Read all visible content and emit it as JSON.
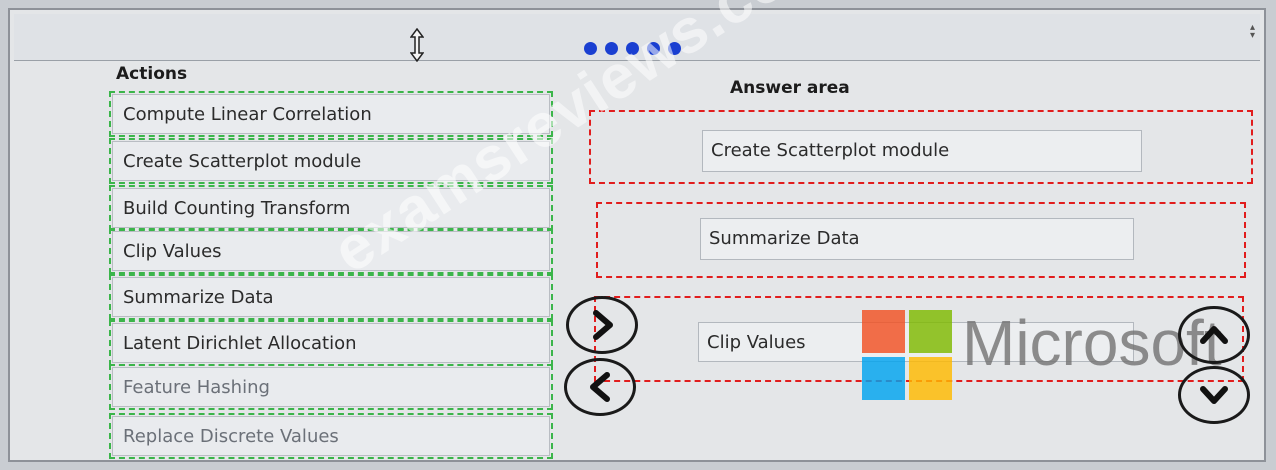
{
  "actions": {
    "title": "Actions",
    "items": [
      "Compute Linear Correlation",
      "Create Scatterplot module",
      "Build Counting Transform",
      "Clip Values",
      "Summarize Data",
      "Latent Dirichlet Allocation",
      "Feature Hashing",
      "Replace Discrete Values"
    ]
  },
  "answer_area": {
    "title": "Answer area",
    "items": [
      "Create Scatterplot module",
      "Summarize Data",
      "Clip Values"
    ]
  },
  "watermark_text": "examsreviews.com",
  "logo": {
    "word": "Microsoft",
    "colors": [
      "#f25022",
      "#7fba00",
      "#00a4ef",
      "#ffb900"
    ]
  },
  "icons": {
    "resize": "vertical-resize-icon",
    "pager": "pager-dots-icon",
    "scroll": "scroll-arrows-icon",
    "move_right": "chevron-right-icon",
    "move_left": "chevron-left-icon",
    "move_up": "chevron-up-icon",
    "move_down": "chevron-down-icon"
  },
  "colors": {
    "source_border": "#3bb54a",
    "target_border": "#e11d1d",
    "pager_dot": "#1a3fd1"
  }
}
